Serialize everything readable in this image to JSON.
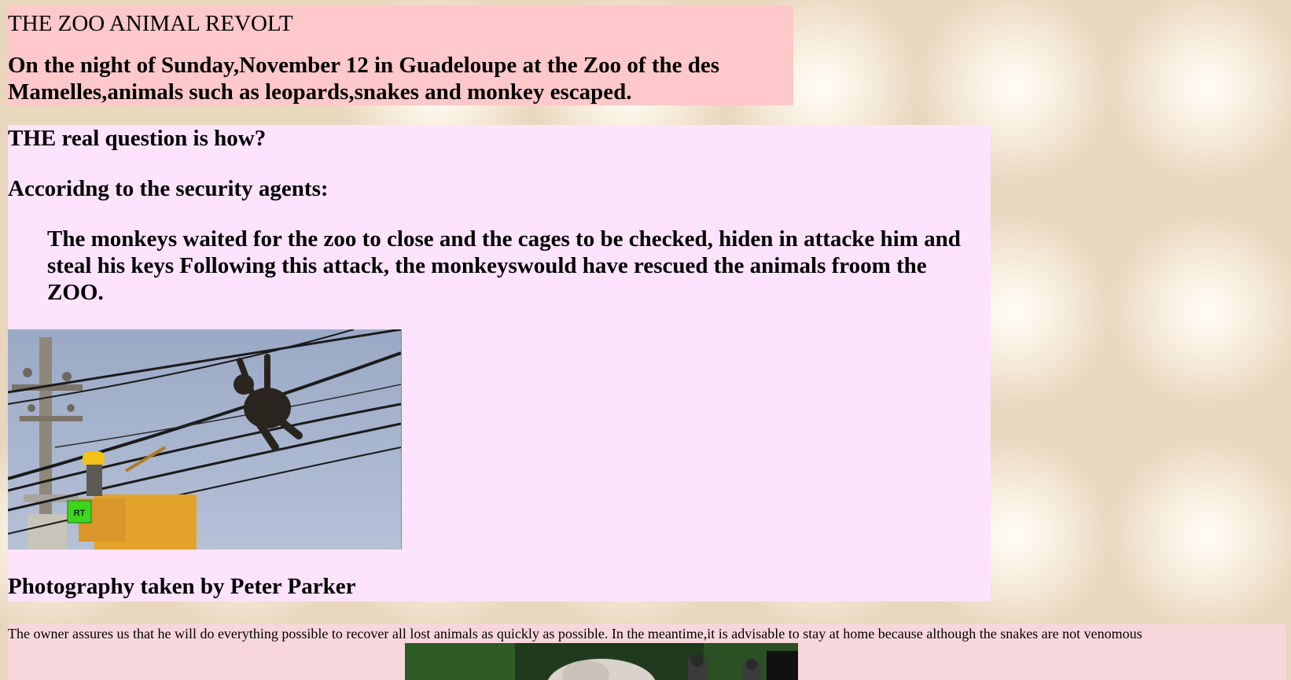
{
  "header": {
    "title": "THE ZOO ANIMAL REVOLT",
    "lead": "On the night of Sunday,November 12 in Guadeloupe at the Zoo of the des Mamelles,animals such as leopards,snakes and monkey escaped."
  },
  "article": {
    "question": "THE real question is how?",
    "agents_intro": "Accoridng to the security agents:",
    "quote": "The monkeys waited for the zoo to close and the cages to be checked, hiden in attacke him and steal his keys Following this attack, the monkeyswould have rescued the animals froom the ZOO.",
    "photo_logo": "RT",
    "credit": "Photography taken by Peter Parker"
  },
  "footer": {
    "owner_text": "The owner assures us that he will do everything possible to recover all lost animals as quickly as possible. In the meantime,it is advisable to stay at home because although the snakes are not venomous"
  },
  "colors": {
    "header_bg": "#ffc8ca",
    "article_bg": "#fde3fc",
    "footer_bg": "#f8d7dc",
    "page_bg": "#e8d6bd"
  }
}
